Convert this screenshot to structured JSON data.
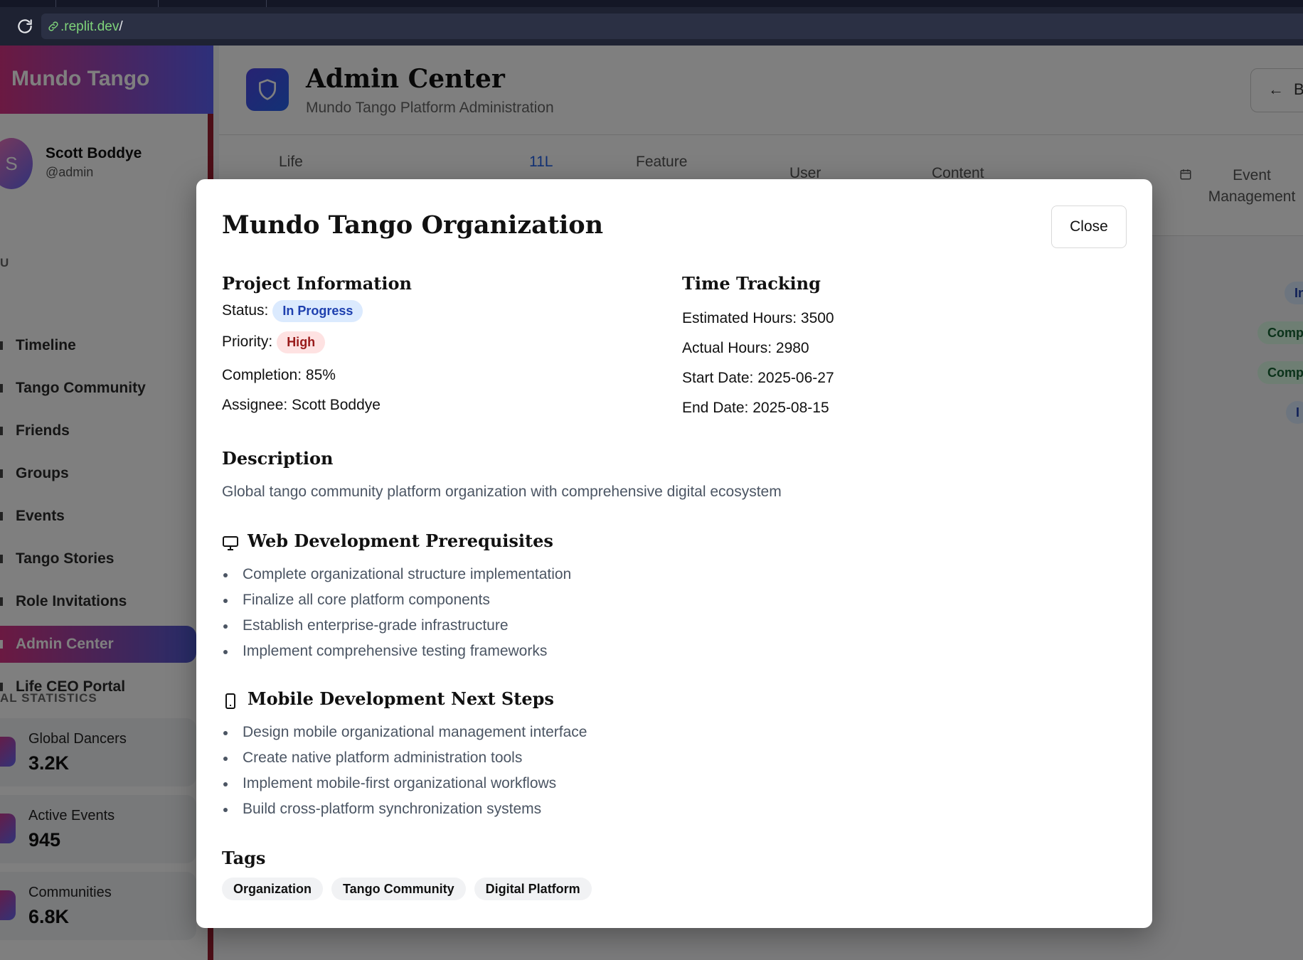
{
  "browser": {
    "url_host": ".replit.dev",
    "url_path": "/"
  },
  "sidebar": {
    "brand": "Mundo Tango",
    "user": {
      "initial": "S",
      "name": "Scott Boddye",
      "handle": "@admin"
    },
    "menu_label": "U",
    "items": [
      {
        "label": "Timeline"
      },
      {
        "label": "Tango Community"
      },
      {
        "label": "Friends"
      },
      {
        "label": "Groups"
      },
      {
        "label": "Events"
      },
      {
        "label": "Tango Stories"
      },
      {
        "label": "Role Invitations"
      },
      {
        "label": "Admin Center",
        "active": true
      },
      {
        "label": "Life CEO Portal"
      }
    ],
    "stats_label": "AL STATISTICS",
    "stats": [
      {
        "label": "Global Dancers",
        "value": "3.2K"
      },
      {
        "label": "Active Events",
        "value": "945"
      },
      {
        "label": "Communities",
        "value": "6.8K"
      }
    ]
  },
  "header": {
    "title": "Admin Center",
    "subtitle": "Mundo Tango Platform Administration",
    "back_label": "B"
  },
  "tabs": [
    {
      "label": "Life"
    },
    {
      "label": "11L",
      "active": true
    },
    {
      "label": "Feature"
    },
    {
      "label": "User"
    },
    {
      "label": "Content"
    },
    {
      "label": "Event Management"
    }
  ],
  "background_pills": [
    "In",
    "Comp",
    "Comp",
    "I"
  ],
  "modal": {
    "title": "Mundo Tango Organization",
    "close_label": "Close",
    "project_info": {
      "heading": "Project Information",
      "status_label": "Status:",
      "status_value": "In Progress",
      "priority_label": "Priority:",
      "priority_value": "High",
      "completion": "Completion: 85%",
      "assignee": "Assignee: Scott Boddye"
    },
    "time_tracking": {
      "heading": "Time Tracking",
      "estimated": "Estimated Hours: 3500",
      "actual": "Actual Hours: 2980",
      "start": "Start Date: 2025-06-27",
      "end": "End Date: 2025-08-15"
    },
    "description": {
      "heading": "Description",
      "text": "Global tango community platform organization with comprehensive digital ecosystem"
    },
    "web_prereq": {
      "heading": "Web Development Prerequisites",
      "icon": "monitor-icon",
      "items": [
        "Complete organizational structure implementation",
        "Finalize all core platform components",
        "Establish enterprise-grade infrastructure",
        "Implement comprehensive testing frameworks"
      ]
    },
    "mobile_next": {
      "heading": "Mobile Development Next Steps",
      "icon": "smartphone-icon",
      "items": [
        "Design mobile organizational management interface",
        "Create native platform administration tools",
        "Implement mobile-first organizational workflows",
        "Build cross-platform synchronization systems"
      ]
    },
    "tags": {
      "heading": "Tags",
      "items": [
        "Organization",
        "Tango Community",
        "Digital Platform"
      ]
    }
  },
  "colors": {
    "status_bg": "#dbeafe",
    "status_text": "#1e40af",
    "priority_bg": "#fee2e2",
    "priority_text": "#991b1b",
    "brand_start": "#d63384",
    "brand_end": "#5b5ff5"
  }
}
